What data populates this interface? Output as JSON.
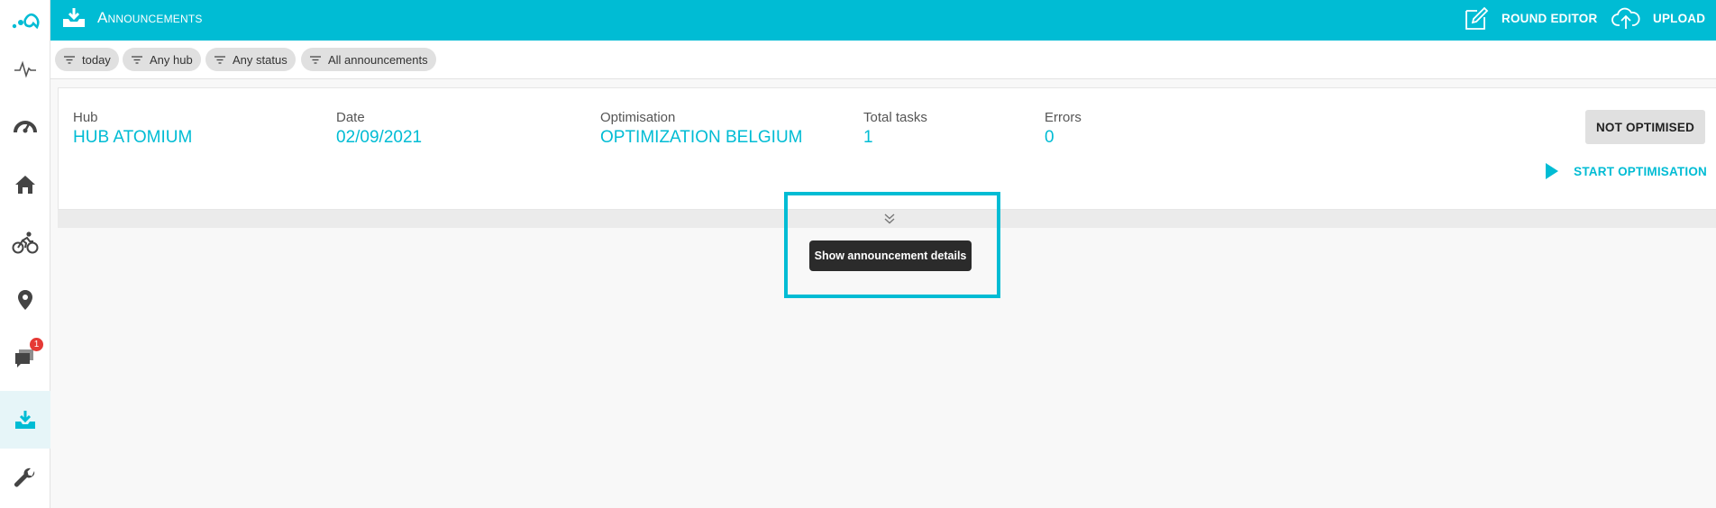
{
  "app": {
    "title": "Announcements",
    "accent_color": "#00bcd4"
  },
  "topbar": {
    "title_icon": "download-tray-icon",
    "actions": [
      {
        "label": "ROUND EDITOR",
        "icon": "edit-icon"
      },
      {
        "label": "UPLOAD",
        "icon": "cloud-upload-icon"
      }
    ]
  },
  "sidebar": {
    "logo": "app-logo",
    "items": [
      {
        "icon": "activity-icon"
      },
      {
        "icon": "dashboard-gauge-icon"
      },
      {
        "icon": "home-icon"
      },
      {
        "icon": "bicycle-icon"
      },
      {
        "icon": "location-pin-icon"
      },
      {
        "icon": "chat-icon",
        "badge": "1"
      },
      {
        "icon": "download-tray-icon",
        "active": true
      },
      {
        "icon": "wrench-icon"
      }
    ]
  },
  "filters": [
    {
      "label": "today"
    },
    {
      "label": "Any hub"
    },
    {
      "label": "Any status"
    },
    {
      "label": "All announcements"
    }
  ],
  "announcement": {
    "fields": [
      {
        "label": "Hub",
        "value": "HUB ATOMIUM"
      },
      {
        "label": "Date",
        "value": "02/09/2021"
      },
      {
        "label": "Optimisation",
        "value": "OPTIMIZATION BELGIUM"
      },
      {
        "label": "Total tasks",
        "value": "1"
      },
      {
        "label": "Errors",
        "value": "0"
      }
    ],
    "status": "NOT OPTIMISED",
    "start_action": "START OPTIMISATION",
    "expand_tooltip": "Show announcement details"
  }
}
